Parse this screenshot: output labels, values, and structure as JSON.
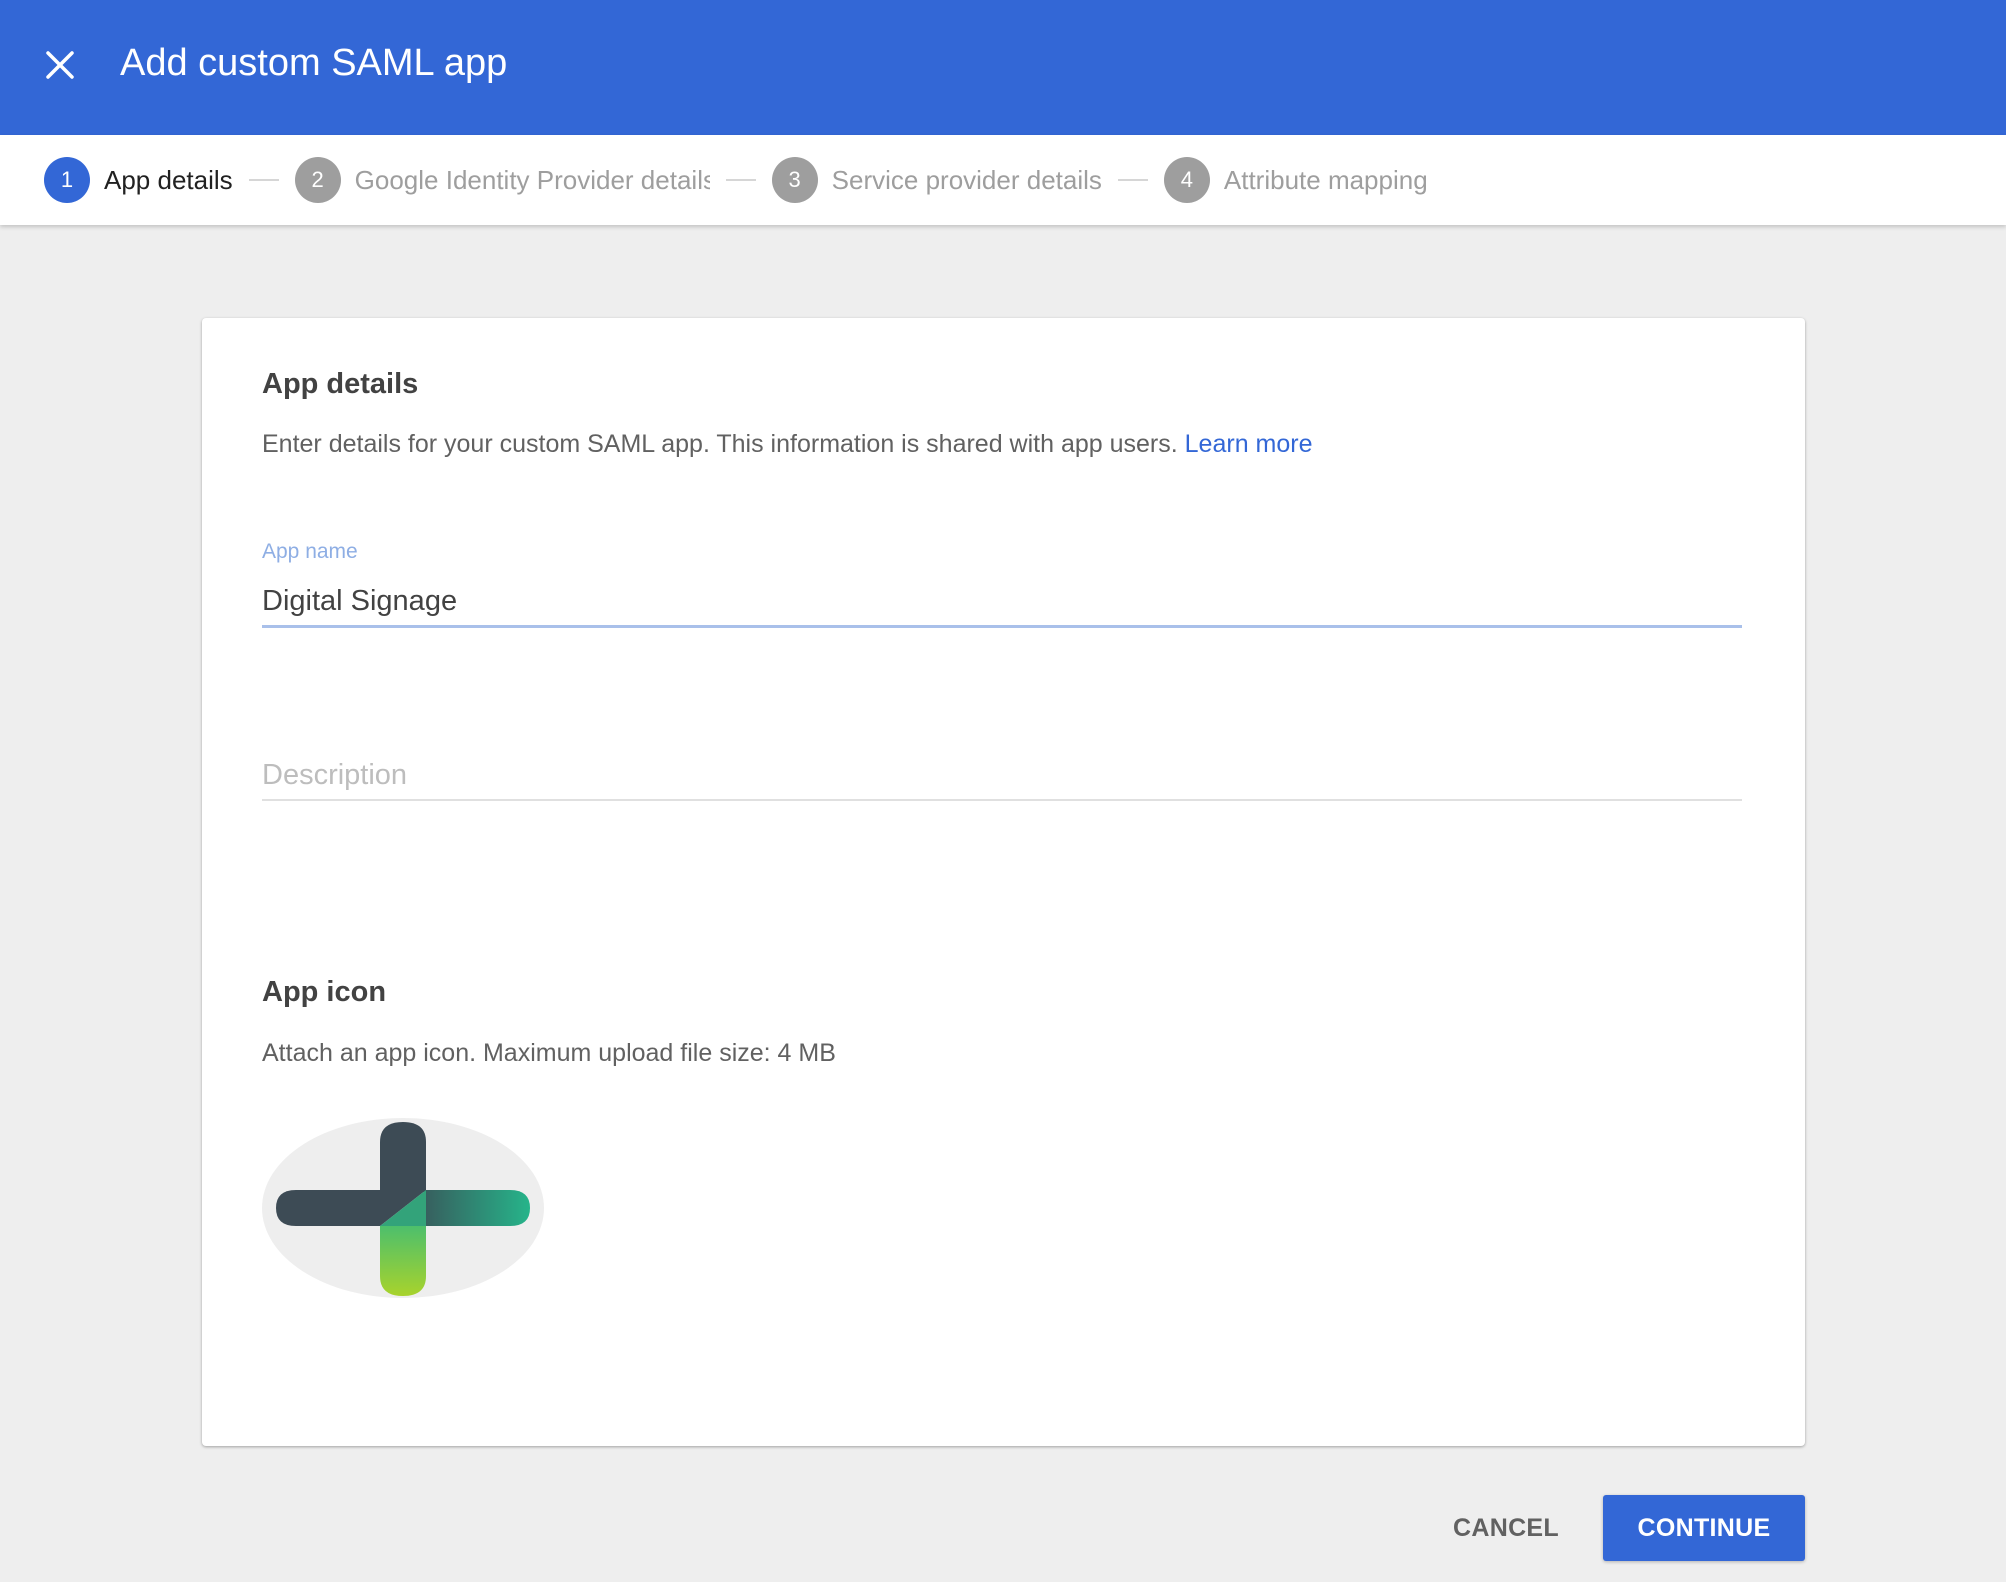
{
  "header": {
    "title": "Add custom SAML app",
    "close_icon": "close-icon",
    "background_color": "#3367d6"
  },
  "stepper": {
    "steps": [
      {
        "number": "1",
        "label": "App details",
        "active": true
      },
      {
        "number": "2",
        "label": "Google Identity Provider details",
        "active": false
      },
      {
        "number": "3",
        "label": "Service provider details",
        "active": false
      },
      {
        "number": "4",
        "label": "Attribute mapping",
        "active": false
      }
    ]
  },
  "app_details": {
    "title": "App details",
    "description": "Enter details for your custom SAML app. This information is shared with app users.",
    "learn_more": "Learn more",
    "app_name_label": "App name",
    "app_name_value": "Digital Signage",
    "description_placeholder": "Description",
    "description_value": ""
  },
  "app_icon": {
    "title": "App icon",
    "description": "Attach an app icon. Maximum upload file size: 4 MB",
    "icon": "app-logo-cross-icon"
  },
  "actions": {
    "cancel_label": "CANCEL",
    "continue_label": "CONTINUE"
  },
  "colors": {
    "accent": "#3367d6",
    "inactive_step": "#9e9e9e",
    "link": "#3367d6"
  }
}
